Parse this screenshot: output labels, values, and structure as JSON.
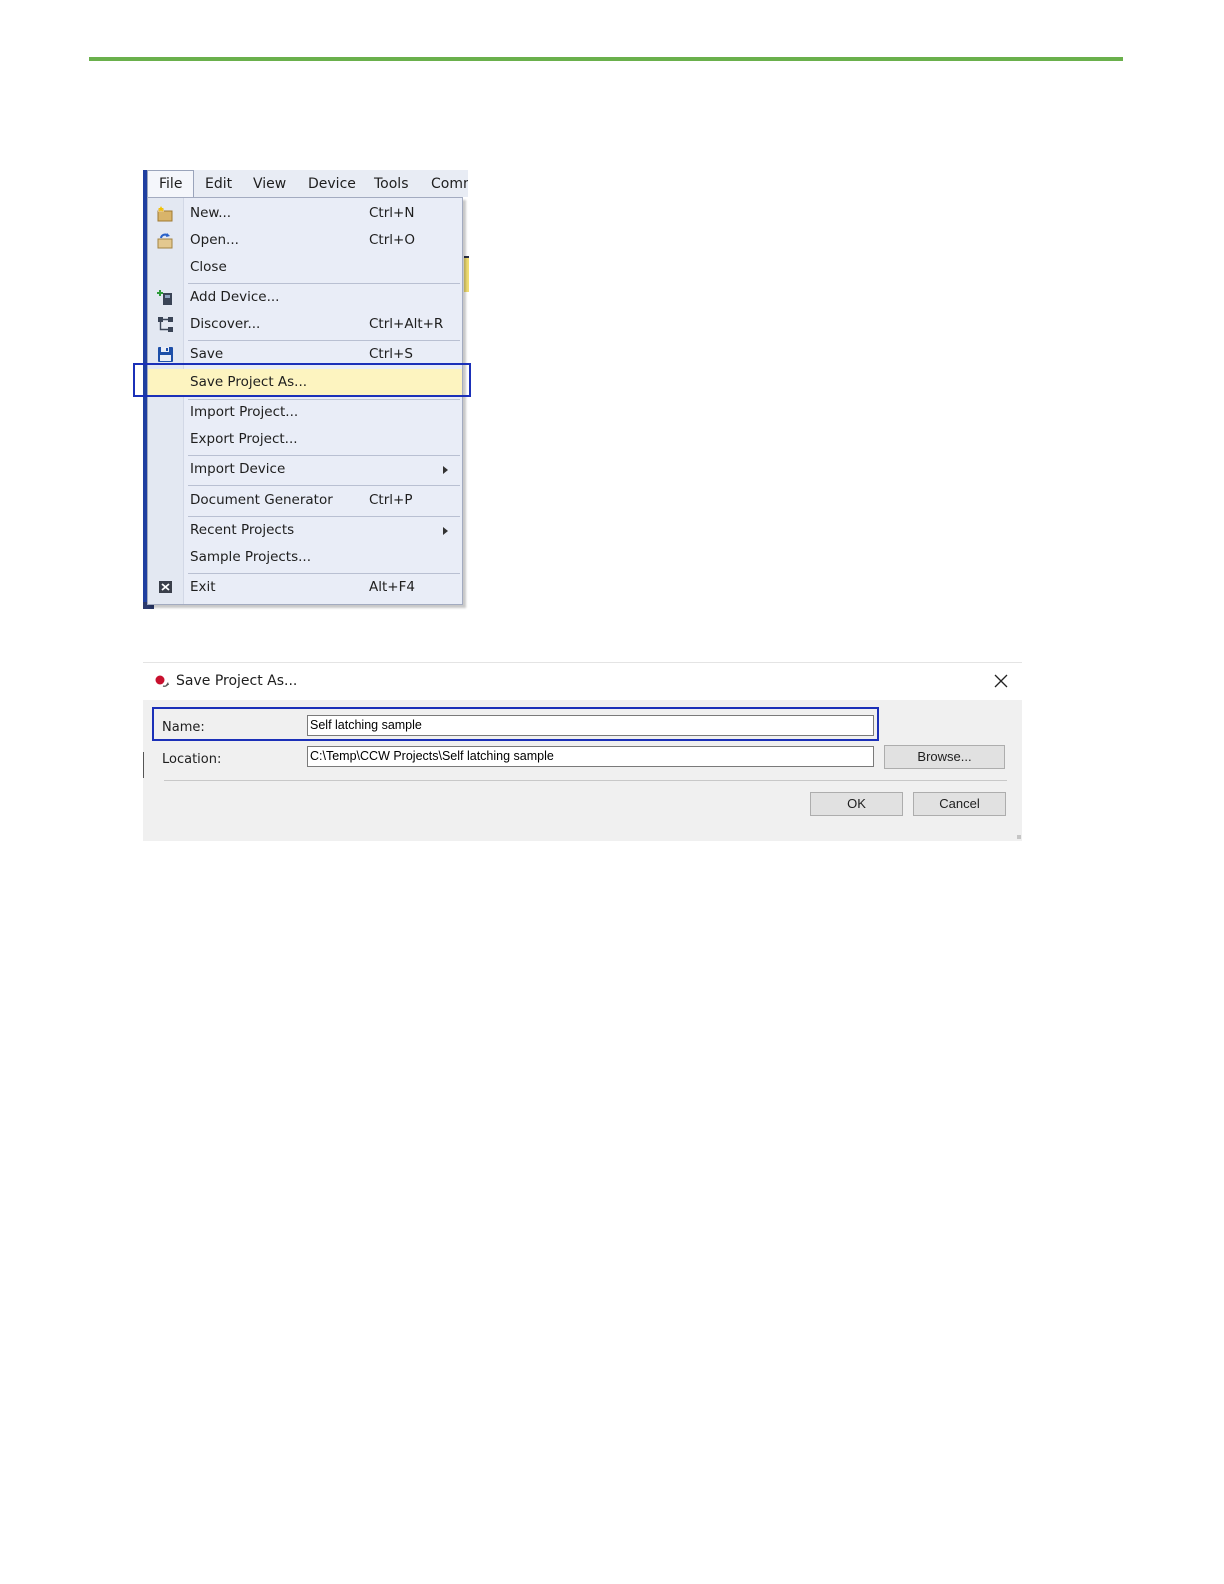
{
  "menubar": {
    "items": [
      "File",
      "Edit",
      "View",
      "Device",
      "Tools",
      "Comm"
    ]
  },
  "file_menu": {
    "items": [
      {
        "label": "New...",
        "shortcut": "Ctrl+N",
        "icon": "new-project-icon"
      },
      {
        "label": "Open...",
        "shortcut": "Ctrl+O",
        "icon": "open-folder-icon"
      },
      {
        "label": "Close",
        "shortcut": ""
      },
      {
        "label": "Add Device...",
        "shortcut": "",
        "icon": "add-device-icon"
      },
      {
        "label": "Discover...",
        "shortcut": "Ctrl+Alt+R",
        "icon": "discover-icon"
      },
      {
        "label": "Save",
        "shortcut": "Ctrl+S",
        "icon": "save-icon"
      },
      {
        "label": "Save Project As...",
        "shortcut": "",
        "highlighted": true
      },
      {
        "label": "Import Project...",
        "shortcut": ""
      },
      {
        "label": "Export Project...",
        "shortcut": ""
      },
      {
        "label": "Import Device",
        "shortcut": "",
        "submenu": true
      },
      {
        "label": "Document Generator",
        "shortcut": "Ctrl+P"
      },
      {
        "label": "Recent Projects",
        "shortcut": "",
        "submenu": true
      },
      {
        "label": "Sample Projects...",
        "shortcut": ""
      },
      {
        "label": "Exit",
        "shortcut": "Alt+F4",
        "icon": "exit-icon"
      }
    ]
  },
  "dialog": {
    "title": "Save Project As...",
    "name_label": "Name:",
    "name_value": "Self latching sample",
    "location_label": "Location:",
    "location_value": "C:\\Temp\\CCW Projects\\Self latching sample",
    "browse_label": "Browse...",
    "ok_label": "OK",
    "cancel_label": "Cancel"
  },
  "colors": {
    "accent_rule": "#6ab04c",
    "callout_frame": "#1b30b8",
    "menu_highlight": "#fdf4c0"
  }
}
